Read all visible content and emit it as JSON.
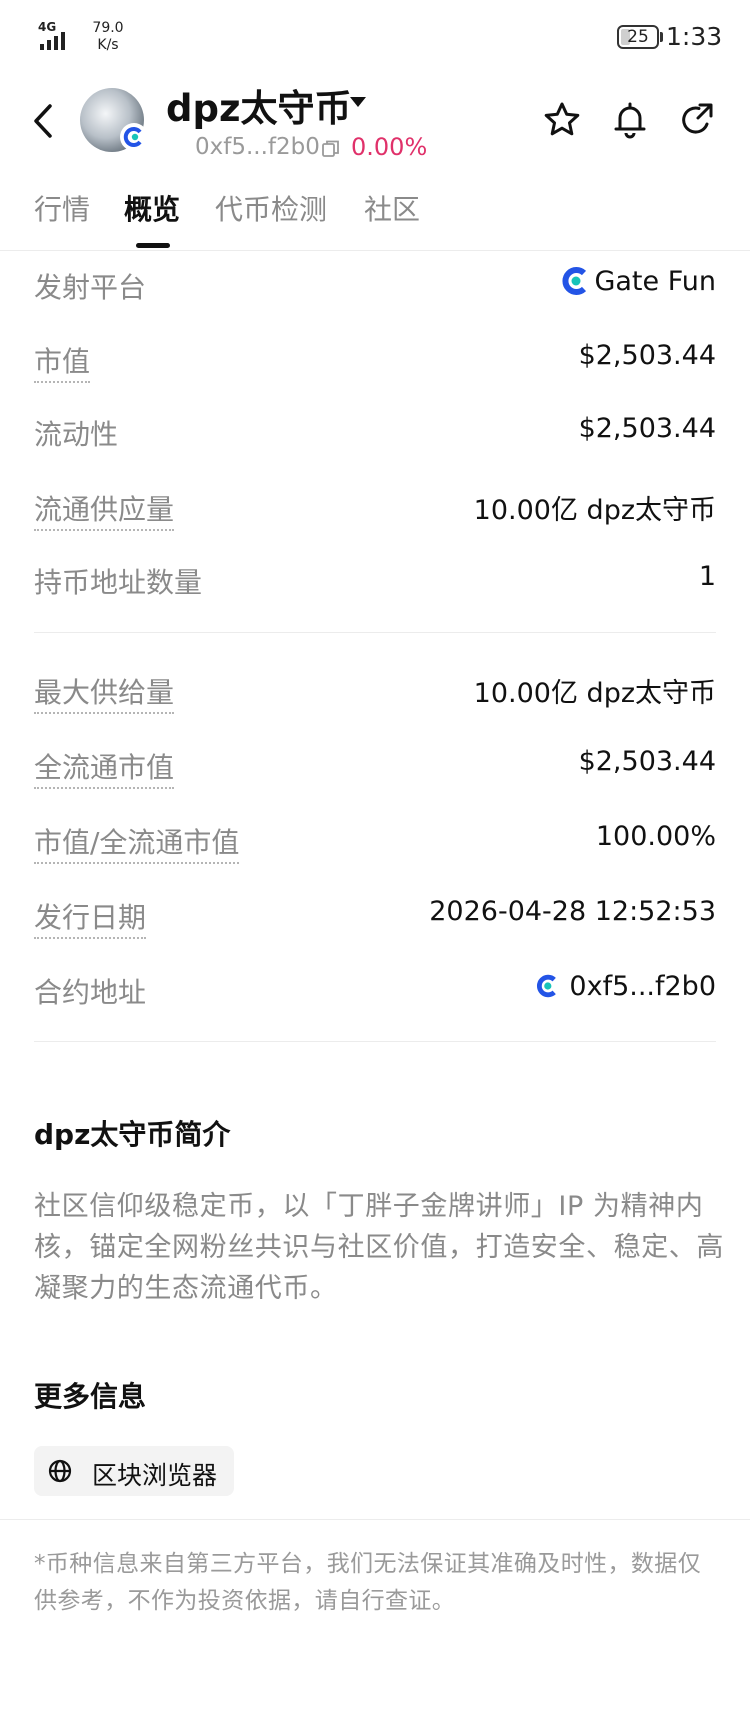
{
  "status_bar": {
    "network": "4G",
    "speed_value": "79.0",
    "speed_unit": "K/s",
    "battery": "25",
    "time": "1:33"
  },
  "header": {
    "token_name": "dpz太守币",
    "address_short": "0xf5...f2b0",
    "change_pct": "0.00%",
    "icons": [
      "back-arrow-icon",
      "star-icon",
      "bell-icon",
      "share-icon",
      "copy-icon"
    ],
    "change_color": "#e0316a"
  },
  "tabs": [
    {
      "label": "行情",
      "active": false
    },
    {
      "label": "概览",
      "active": true
    },
    {
      "label": "代币检测",
      "active": false
    },
    {
      "label": "社区",
      "active": false
    }
  ],
  "overview": {
    "group1": [
      {
        "label": "发射平台",
        "value": "Gate Fun"
      },
      {
        "label": "市值",
        "value": "$2,503.44"
      },
      {
        "label": "流动性",
        "value": "$2,503.44"
      },
      {
        "label": "流通供应量",
        "value": "10.00亿 dpz太守币"
      },
      {
        "label": "持币地址数量",
        "value": "1"
      }
    ],
    "group2": [
      {
        "label": "最大供给量",
        "value": "10.00亿 dpz太守币"
      },
      {
        "label": "全流通市值",
        "value": "$2,503.44"
      },
      {
        "label": "市值/全流通市值",
        "value": "100.00%"
      },
      {
        "label": "发行日期",
        "value": "2026-04-28 12:52:53"
      },
      {
        "label": "合约地址",
        "value": "0xf5...f2b0"
      }
    ]
  },
  "intro": {
    "title": "dpz太守币简介",
    "text": "社区信仰级稳定币，以「丁胖子金牌讲师」IP 为精神内核，锚定全网粉丝共识与社区价值，打造安全、稳定、高凝聚力的生态流通代币。"
  },
  "more_info": {
    "title": "更多信息",
    "explorer_label": "区块浏览器"
  },
  "disclaimer": "*币种信息来自第三方平台，我们无法保证其准确及时性，数据仅供参考，不作为投资依据，请自行查证。",
  "colors": {
    "gate_blue": "#2354e6",
    "gate_cyan": "#17c3b9"
  }
}
